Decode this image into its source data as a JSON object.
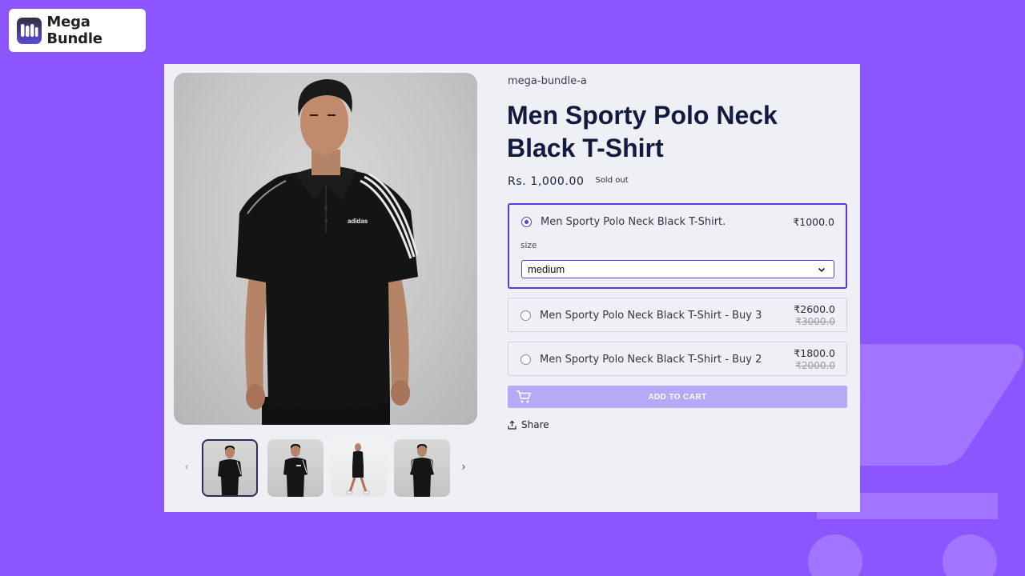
{
  "brand": {
    "name": "Mega Bundle",
    "accent": "#8b55ff"
  },
  "product": {
    "vendor": "mega-bundle-a",
    "title": "Men Sporty Polo Neck Black T-Shirt",
    "price": "Rs. 1,000.00",
    "badge": "Sold out"
  },
  "gallery": {
    "prev_icon": "chevron-left-icon",
    "next_icon": "chevron-right-icon",
    "thumbnail_count": 4,
    "selected_thumbnail": 1
  },
  "bundle_options": [
    {
      "label": "Men Sporty Polo Neck Black T-Shirt.",
      "price": "₹1000.0",
      "compare_price": "",
      "selected": true,
      "size_label": "size",
      "size_value": "medium"
    },
    {
      "label": "Men Sporty Polo Neck Black T-Shirt - Buy 3",
      "price": "₹2600.0",
      "compare_price": "₹3000.0",
      "selected": false
    },
    {
      "label": "Men Sporty Polo Neck Black T-Shirt - Buy 2",
      "price": "₹1800.0",
      "compare_price": "₹2000.0",
      "selected": false
    }
  ],
  "add_to_cart": {
    "label": "ADD TO CART",
    "icon": "cart-icon",
    "color": "#b7a8f8"
  },
  "share": {
    "label": "Share",
    "icon": "share-icon"
  },
  "colors": {
    "selected_border": "#5b36e6",
    "title": "#131a3f",
    "card_bg": "#eef0f6"
  }
}
